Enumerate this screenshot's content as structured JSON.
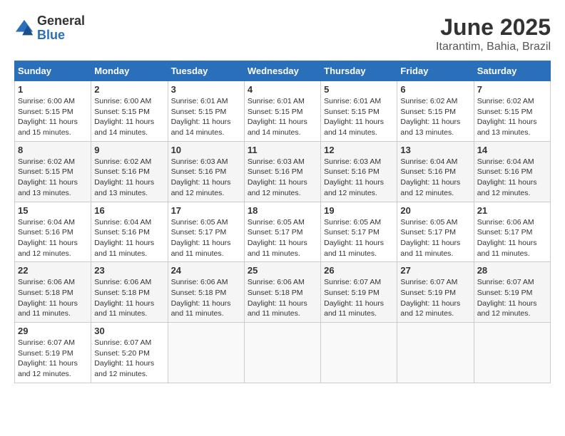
{
  "header": {
    "logo_general": "General",
    "logo_blue": "Blue",
    "title": "June 2025",
    "subtitle": "Itarantim, Bahia, Brazil"
  },
  "calendar": {
    "days_of_week": [
      "Sunday",
      "Monday",
      "Tuesday",
      "Wednesday",
      "Thursday",
      "Friday",
      "Saturday"
    ],
    "weeks": [
      [
        null,
        {
          "day": "2",
          "sunrise": "Sunrise: 6:00 AM",
          "sunset": "Sunset: 5:15 PM",
          "daylight": "Daylight: 11 hours and 14 minutes."
        },
        {
          "day": "3",
          "sunrise": "Sunrise: 6:01 AM",
          "sunset": "Sunset: 5:15 PM",
          "daylight": "Daylight: 11 hours and 14 minutes."
        },
        {
          "day": "4",
          "sunrise": "Sunrise: 6:01 AM",
          "sunset": "Sunset: 5:15 PM",
          "daylight": "Daylight: 11 hours and 14 minutes."
        },
        {
          "day": "5",
          "sunrise": "Sunrise: 6:01 AM",
          "sunset": "Sunset: 5:15 PM",
          "daylight": "Daylight: 11 hours and 14 minutes."
        },
        {
          "day": "6",
          "sunrise": "Sunrise: 6:02 AM",
          "sunset": "Sunset: 5:15 PM",
          "daylight": "Daylight: 11 hours and 13 minutes."
        },
        {
          "day": "7",
          "sunrise": "Sunrise: 6:02 AM",
          "sunset": "Sunset: 5:15 PM",
          "daylight": "Daylight: 11 hours and 13 minutes."
        }
      ],
      [
        {
          "day": "1",
          "sunrise": "Sunrise: 6:00 AM",
          "sunset": "Sunset: 5:15 PM",
          "daylight": "Daylight: 11 hours and 15 minutes."
        },
        null,
        null,
        null,
        null,
        null,
        null
      ],
      [
        {
          "day": "8",
          "sunrise": "Sunrise: 6:02 AM",
          "sunset": "Sunset: 5:15 PM",
          "daylight": "Daylight: 11 hours and 13 minutes."
        },
        {
          "day": "9",
          "sunrise": "Sunrise: 6:02 AM",
          "sunset": "Sunset: 5:16 PM",
          "daylight": "Daylight: 11 hours and 13 minutes."
        },
        {
          "day": "10",
          "sunrise": "Sunrise: 6:03 AM",
          "sunset": "Sunset: 5:16 PM",
          "daylight": "Daylight: 11 hours and 12 minutes."
        },
        {
          "day": "11",
          "sunrise": "Sunrise: 6:03 AM",
          "sunset": "Sunset: 5:16 PM",
          "daylight": "Daylight: 11 hours and 12 minutes."
        },
        {
          "day": "12",
          "sunrise": "Sunrise: 6:03 AM",
          "sunset": "Sunset: 5:16 PM",
          "daylight": "Daylight: 11 hours and 12 minutes."
        },
        {
          "day": "13",
          "sunrise": "Sunrise: 6:04 AM",
          "sunset": "Sunset: 5:16 PM",
          "daylight": "Daylight: 11 hours and 12 minutes."
        },
        {
          "day": "14",
          "sunrise": "Sunrise: 6:04 AM",
          "sunset": "Sunset: 5:16 PM",
          "daylight": "Daylight: 11 hours and 12 minutes."
        }
      ],
      [
        {
          "day": "15",
          "sunrise": "Sunrise: 6:04 AM",
          "sunset": "Sunset: 5:16 PM",
          "daylight": "Daylight: 11 hours and 12 minutes."
        },
        {
          "day": "16",
          "sunrise": "Sunrise: 6:04 AM",
          "sunset": "Sunset: 5:16 PM",
          "daylight": "Daylight: 11 hours and 11 minutes."
        },
        {
          "day": "17",
          "sunrise": "Sunrise: 6:05 AM",
          "sunset": "Sunset: 5:17 PM",
          "daylight": "Daylight: 11 hours and 11 minutes."
        },
        {
          "day": "18",
          "sunrise": "Sunrise: 6:05 AM",
          "sunset": "Sunset: 5:17 PM",
          "daylight": "Daylight: 11 hours and 11 minutes."
        },
        {
          "day": "19",
          "sunrise": "Sunrise: 6:05 AM",
          "sunset": "Sunset: 5:17 PM",
          "daylight": "Daylight: 11 hours and 11 minutes."
        },
        {
          "day": "20",
          "sunrise": "Sunrise: 6:05 AM",
          "sunset": "Sunset: 5:17 PM",
          "daylight": "Daylight: 11 hours and 11 minutes."
        },
        {
          "day": "21",
          "sunrise": "Sunrise: 6:06 AM",
          "sunset": "Sunset: 5:17 PM",
          "daylight": "Daylight: 11 hours and 11 minutes."
        }
      ],
      [
        {
          "day": "22",
          "sunrise": "Sunrise: 6:06 AM",
          "sunset": "Sunset: 5:18 PM",
          "daylight": "Daylight: 11 hours and 11 minutes."
        },
        {
          "day": "23",
          "sunrise": "Sunrise: 6:06 AM",
          "sunset": "Sunset: 5:18 PM",
          "daylight": "Daylight: 11 hours and 11 minutes."
        },
        {
          "day": "24",
          "sunrise": "Sunrise: 6:06 AM",
          "sunset": "Sunset: 5:18 PM",
          "daylight": "Daylight: 11 hours and 11 minutes."
        },
        {
          "day": "25",
          "sunrise": "Sunrise: 6:06 AM",
          "sunset": "Sunset: 5:18 PM",
          "daylight": "Daylight: 11 hours and 11 minutes."
        },
        {
          "day": "26",
          "sunrise": "Sunrise: 6:07 AM",
          "sunset": "Sunset: 5:19 PM",
          "daylight": "Daylight: 11 hours and 11 minutes."
        },
        {
          "day": "27",
          "sunrise": "Sunrise: 6:07 AM",
          "sunset": "Sunset: 5:19 PM",
          "daylight": "Daylight: 11 hours and 12 minutes."
        },
        {
          "day": "28",
          "sunrise": "Sunrise: 6:07 AM",
          "sunset": "Sunset: 5:19 PM",
          "daylight": "Daylight: 11 hours and 12 minutes."
        }
      ],
      [
        {
          "day": "29",
          "sunrise": "Sunrise: 6:07 AM",
          "sunset": "Sunset: 5:19 PM",
          "daylight": "Daylight: 11 hours and 12 minutes."
        },
        {
          "day": "30",
          "sunrise": "Sunrise: 6:07 AM",
          "sunset": "Sunset: 5:20 PM",
          "daylight": "Daylight: 11 hours and 12 minutes."
        },
        null,
        null,
        null,
        null,
        null
      ]
    ]
  }
}
